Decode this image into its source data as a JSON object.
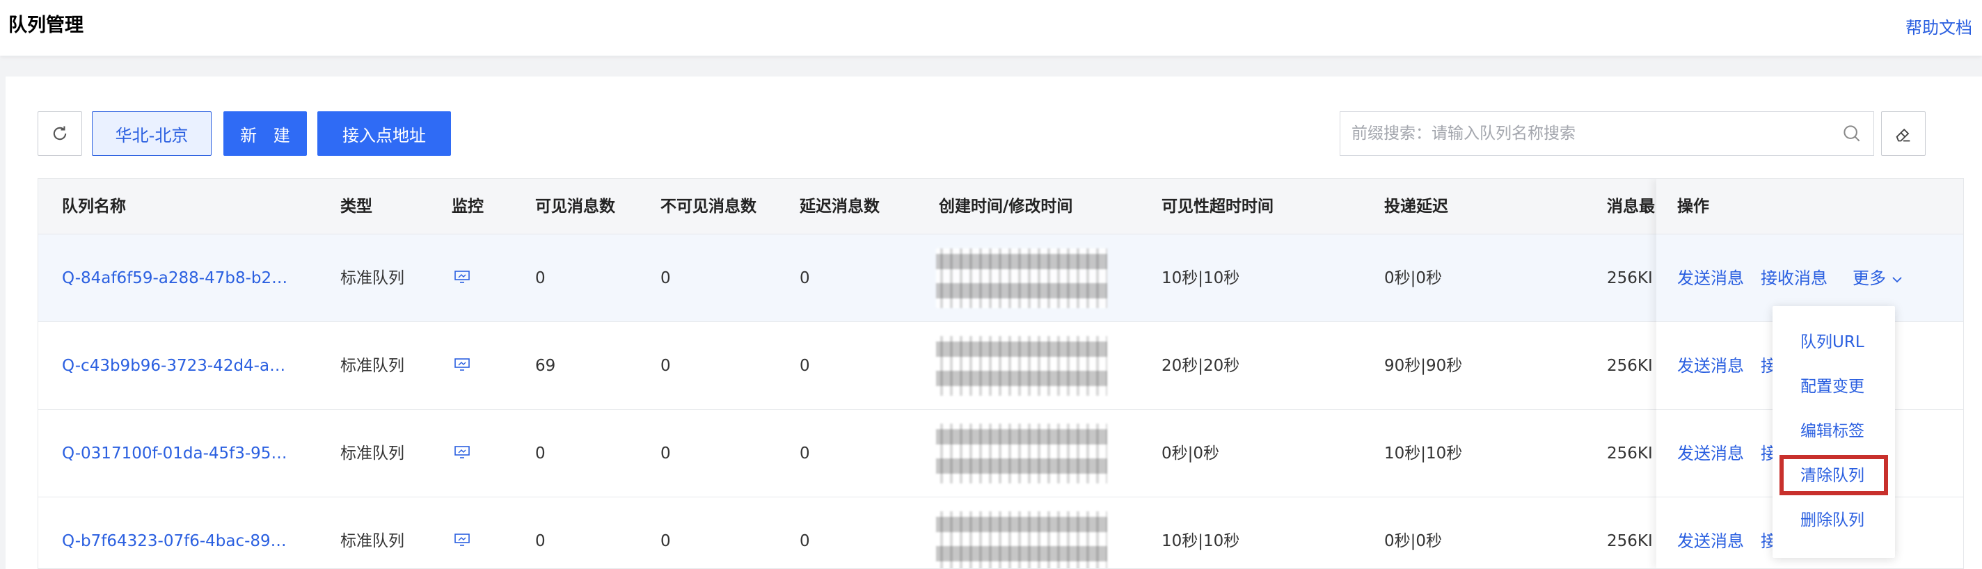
{
  "header": {
    "title": "队列管理",
    "help_link": "帮助文档"
  },
  "toolbar": {
    "refresh_icon": "refresh-icon",
    "region": "华北-北京",
    "new_button": "新 建",
    "endpoint_button": "接入点地址",
    "search_placeholder": "前缀搜索：请输入队列名称搜索",
    "search_icon": "search-icon",
    "edit_icon": "eraser-icon"
  },
  "table": {
    "columns": [
      "队列名称",
      "类型",
      "监控",
      "可见消息数",
      "不可见消息数",
      "延迟消息数",
      "创建时间/修改时间",
      "可见性超时时间",
      "投递延迟",
      "消息最",
      "操作"
    ],
    "rows": [
      {
        "name": "Q-84af6f59-a288-47b8-b2…",
        "type": "标准队列",
        "visible": "0",
        "invisible": "0",
        "delayed": "0",
        "timeout": "10秒|10秒",
        "delivery": "0秒|0秒",
        "max": "256KI"
      },
      {
        "name": "Q-c43b9b96-3723-42d4-a…",
        "type": "标准队列",
        "visible": "69",
        "invisible": "0",
        "delayed": "0",
        "timeout": "20秒|20秒",
        "delivery": "90秒|90秒",
        "max": "256KI"
      },
      {
        "name": "Q-0317100f-01da-45f3-95…",
        "type": "标准队列",
        "visible": "0",
        "invisible": "0",
        "delayed": "0",
        "timeout": "0秒|0秒",
        "delivery": "10秒|10秒",
        "max": "256KI"
      },
      {
        "name": "Q-b7f64323-07f6-4bac-89…",
        "type": "标准队列",
        "visible": "0",
        "invisible": "0",
        "delayed": "0",
        "timeout": "10秒|10秒",
        "delivery": "0秒|0秒",
        "max": "256KI"
      }
    ],
    "actions": {
      "send": "发送消息",
      "receive": "接收消息",
      "receive_short": "接",
      "more": "更多"
    }
  },
  "dropdown": {
    "items": [
      "队列URL",
      "配置变更",
      "编辑标签",
      "清除队列",
      "删除队列"
    ],
    "highlighted": "清除队列"
  },
  "colors": {
    "primary": "#2f6bf5",
    "link": "#2a5fe0",
    "highlight_box": "#c8302c"
  }
}
